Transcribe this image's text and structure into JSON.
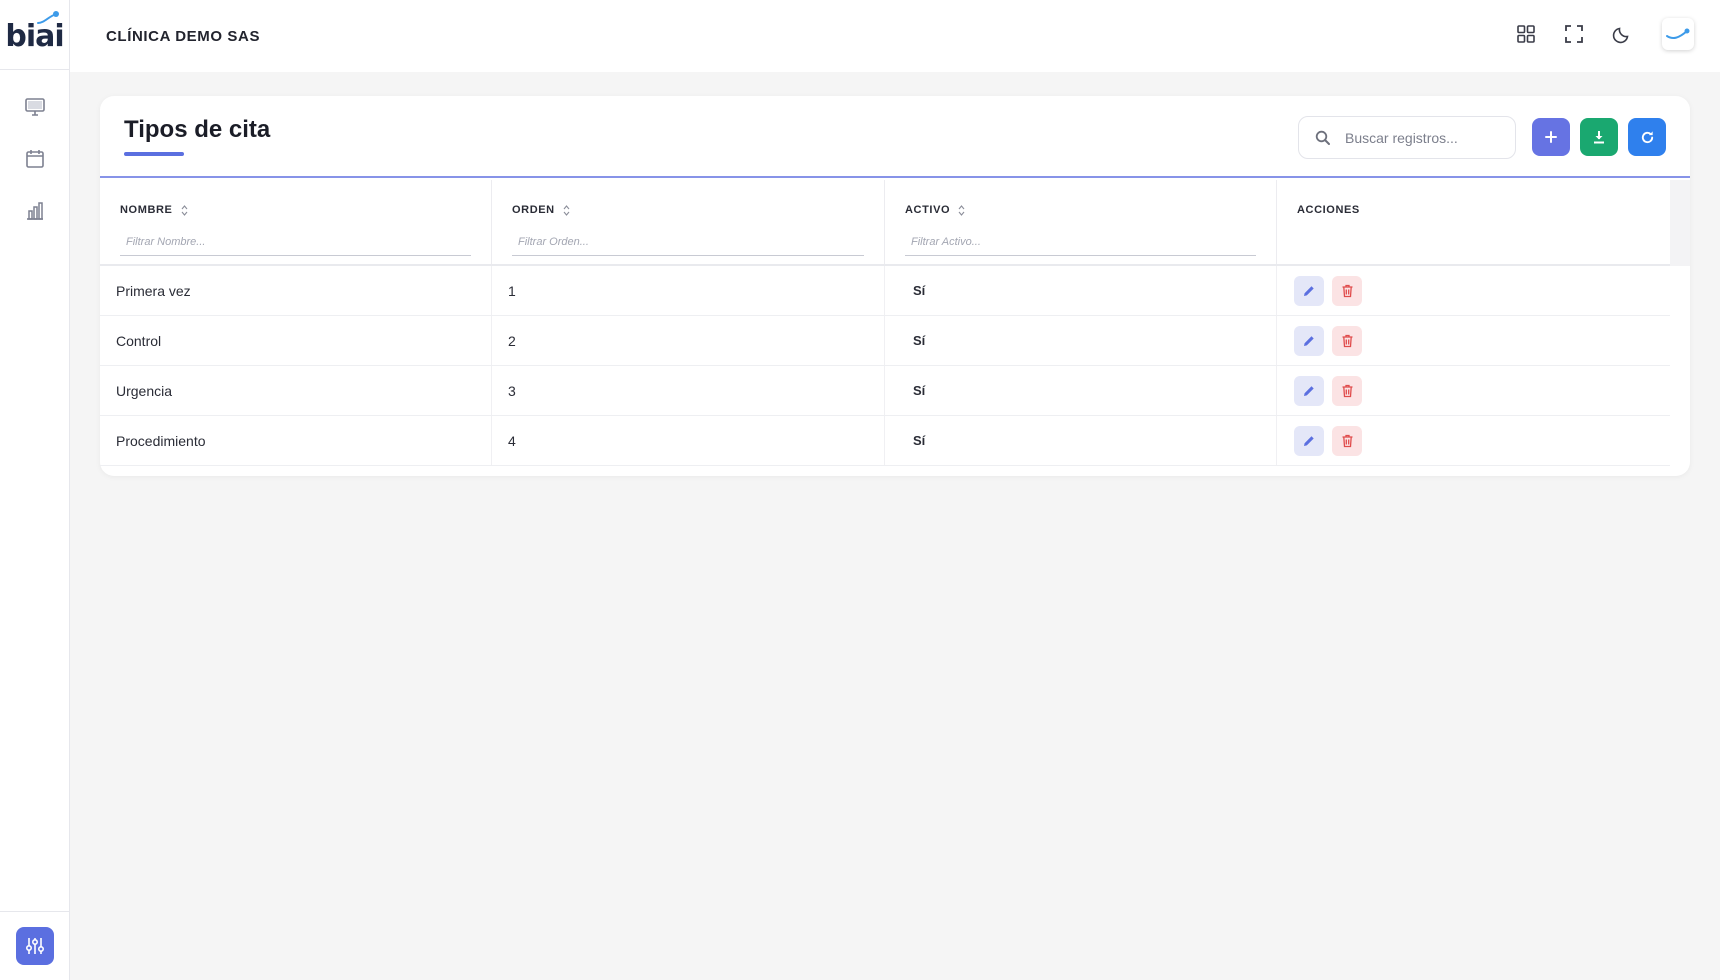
{
  "app": {
    "logo_text": "biai",
    "company": "CLÍNICA DEMO SAS"
  },
  "sidebar": {
    "items": [
      {
        "name": "monitor-icon"
      },
      {
        "name": "calendar-icon"
      },
      {
        "name": "bar-chart-icon"
      }
    ],
    "settings_icon": "sliders-icon"
  },
  "topbar": {
    "icons": [
      "grid-icon",
      "fullscreen-icon",
      "moon-icon"
    ]
  },
  "page": {
    "title": "Tipos de cita",
    "search_placeholder": "Buscar registros...",
    "buttons": {
      "add": "plus-icon",
      "download": "download-icon",
      "refresh": "refresh-icon"
    }
  },
  "table": {
    "columns": [
      {
        "label": "NOMBRE",
        "filter_placeholder": "Filtrar Nombre..."
      },
      {
        "label": "ORDEN",
        "filter_placeholder": "Filtrar Orden..."
      },
      {
        "label": "ACTIVO",
        "filter_placeholder": "Filtrar Activo..."
      },
      {
        "label": "ACCIONES",
        "filter_placeholder": ""
      }
    ],
    "rows": [
      {
        "nombre": "Primera vez",
        "orden": "1",
        "activo": "Sí"
      },
      {
        "nombre": "Control",
        "orden": "2",
        "activo": "Sí"
      },
      {
        "nombre": "Urgencia",
        "orden": "3",
        "activo": "Sí"
      },
      {
        "nombre": "Procedimiento",
        "orden": "4",
        "activo": "Sí"
      }
    ]
  },
  "colors": {
    "primary": "#5b6fe0",
    "success": "#1aa870",
    "info": "#2f80ed",
    "danger": "#e04b4b"
  }
}
